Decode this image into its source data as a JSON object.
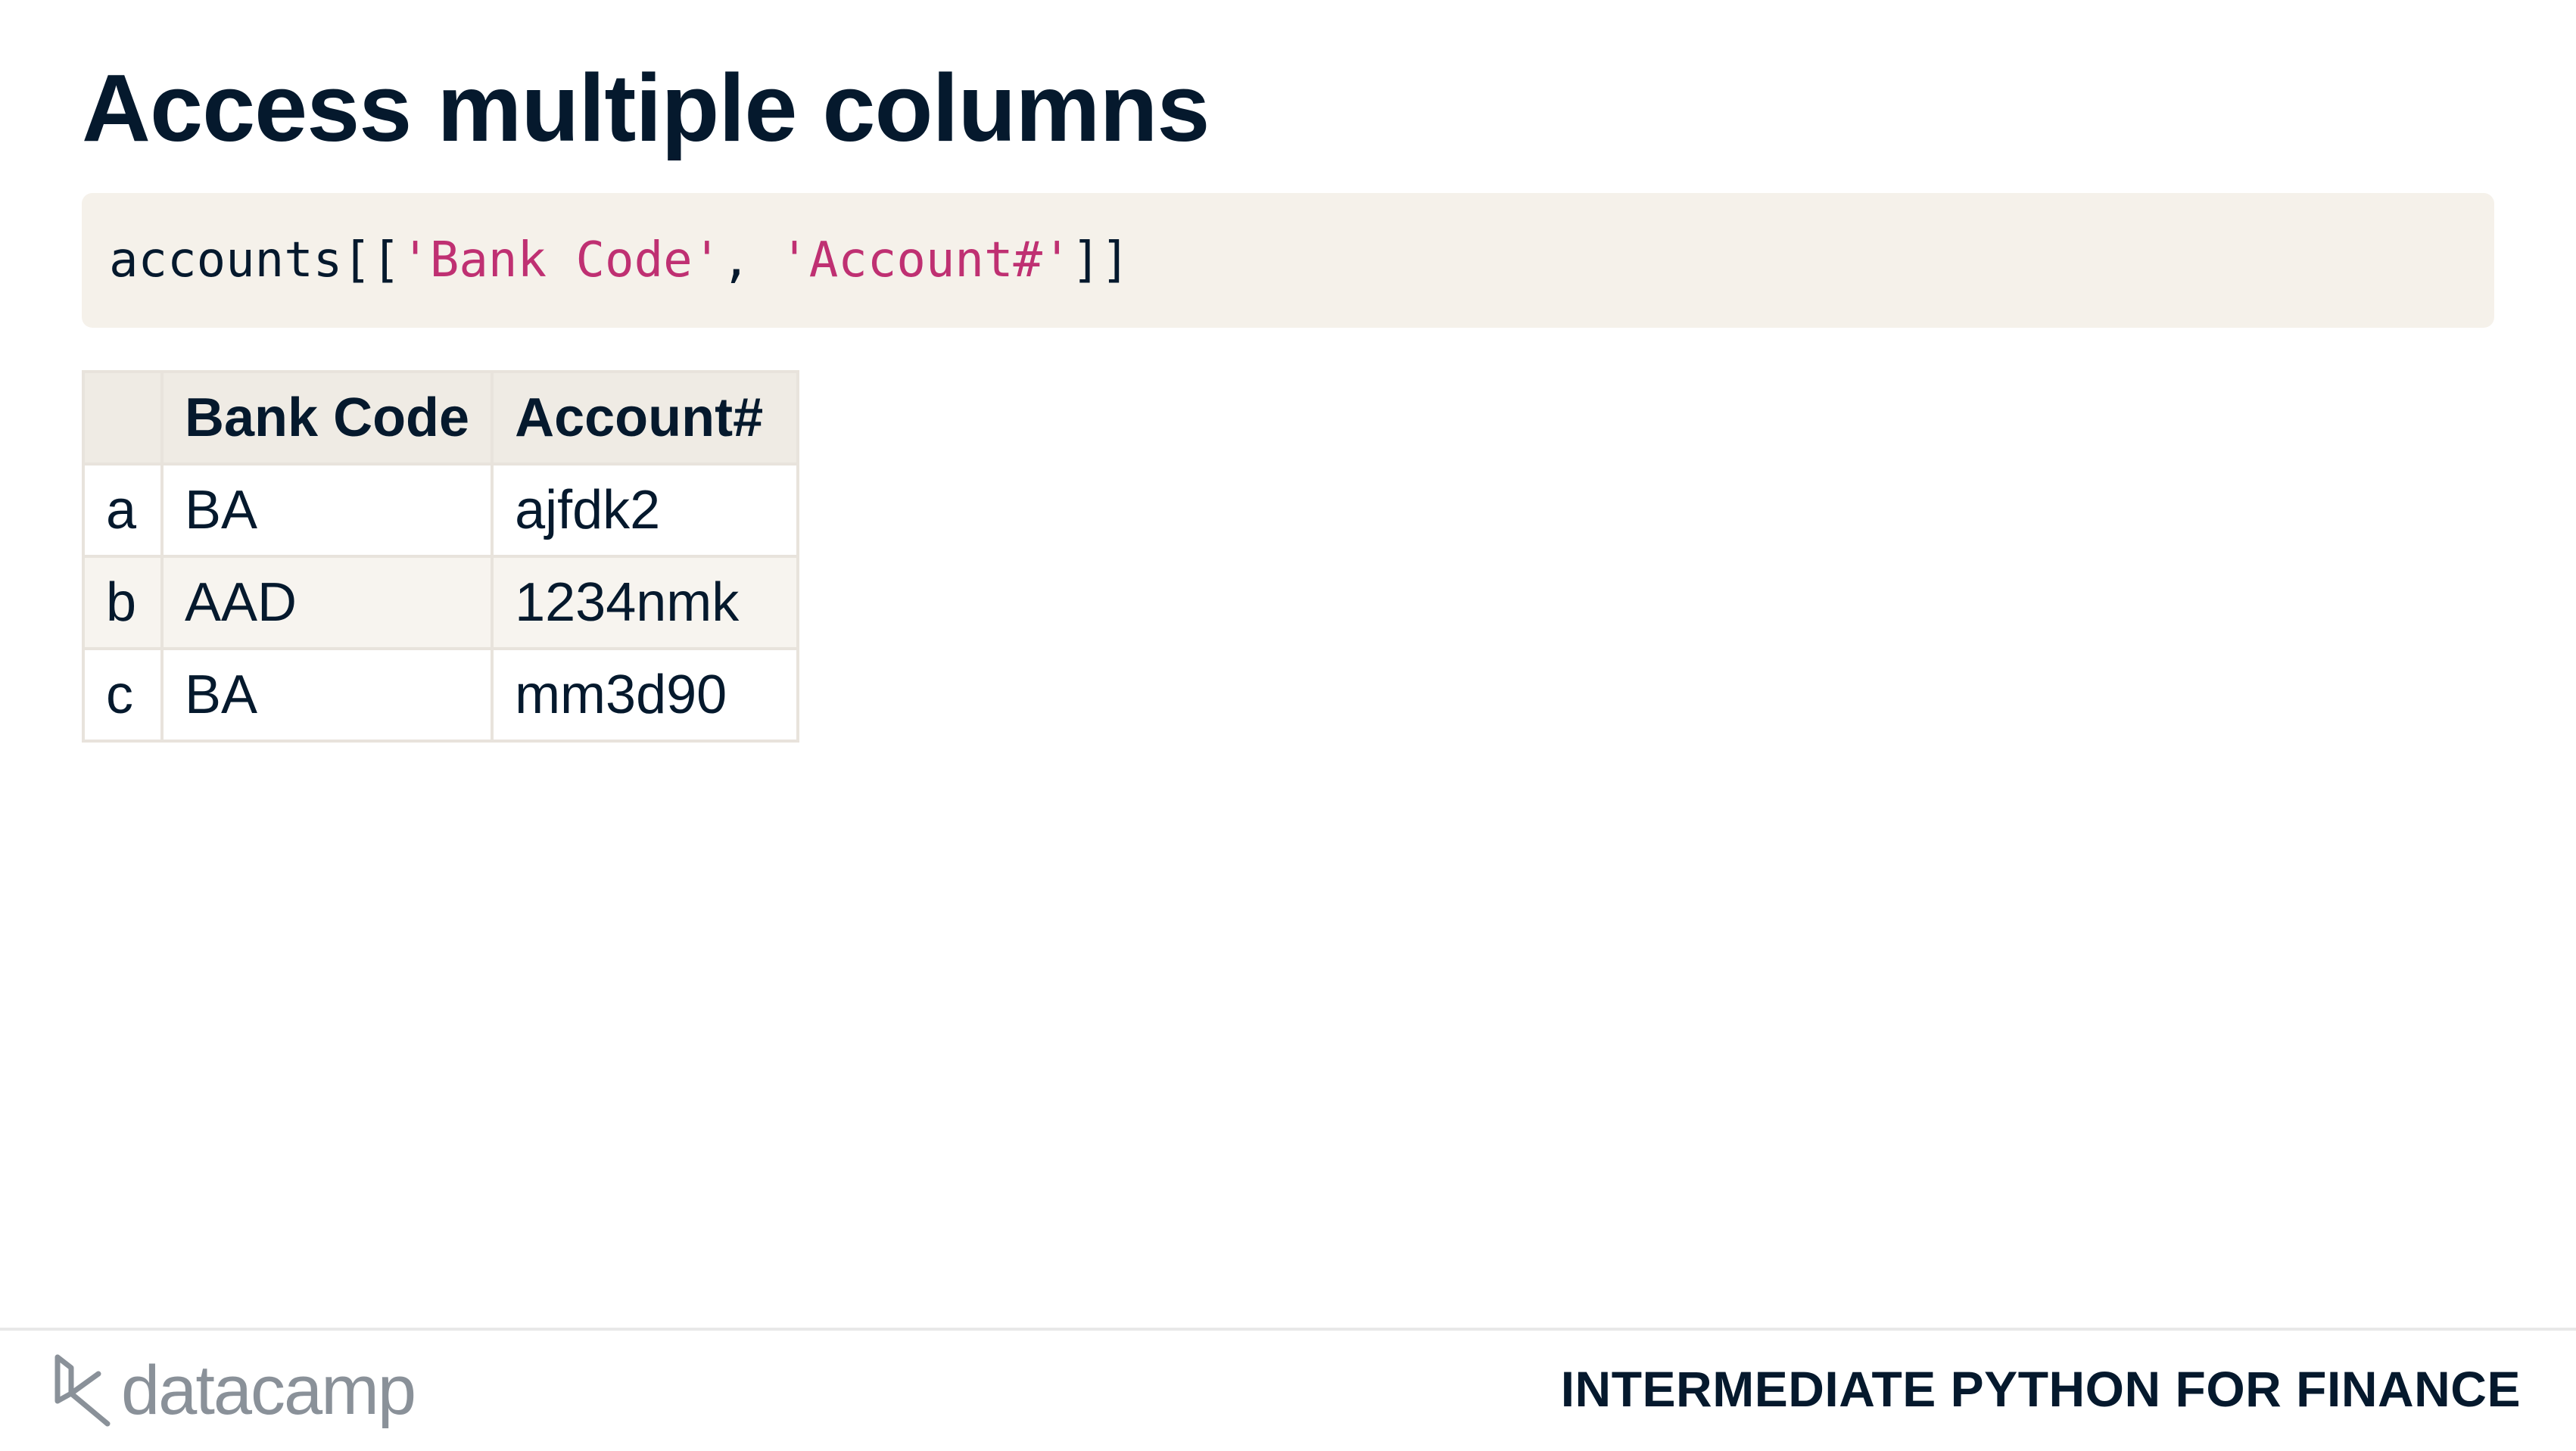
{
  "slide": {
    "title": "Access multiple columns"
  },
  "code": {
    "prefix": "accounts[[",
    "str1": "'Bank Code'",
    "sep": ", ",
    "str2": "'Account#'",
    "suffix": "]]",
    "string_color": "#bf3072"
  },
  "table": {
    "columns": [
      "",
      "Bank Code",
      "Account#"
    ],
    "rows": [
      {
        "index": "a",
        "bank_code": "BA",
        "account": "ajfdk2"
      },
      {
        "index": "b",
        "bank_code": "AAD",
        "account": "1234nmk"
      },
      {
        "index": "c",
        "bank_code": "BA",
        "account": "mm3d90"
      }
    ]
  },
  "footer": {
    "brand": "datacamp",
    "brand_icon": "datacamp-logo-icon",
    "course": "INTERMEDIATE PYTHON FOR FINANCE"
  }
}
